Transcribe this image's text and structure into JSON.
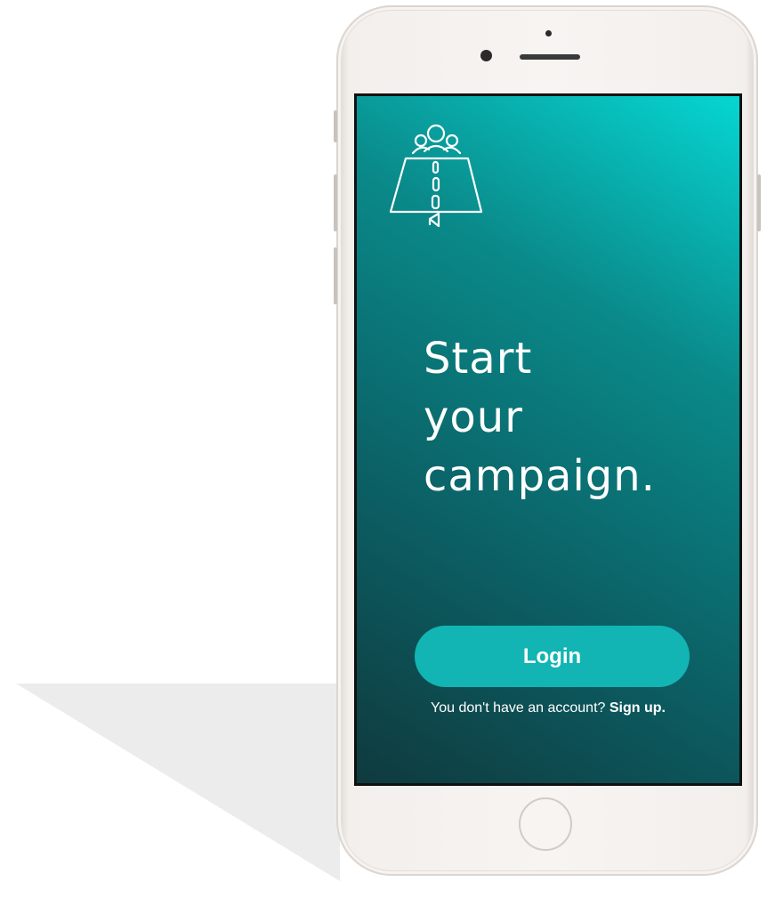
{
  "screen": {
    "logo": {
      "icon": "campaign-road-icon"
    },
    "headline": {
      "line1": "Start",
      "line2": "your",
      "line3": "campaign."
    },
    "login_button": {
      "label": "Login"
    },
    "signup_prompt": {
      "text": "You don't have an account? ",
      "link_label": "Sign up."
    }
  },
  "colors": {
    "gradient_dark": "#0f3a3e",
    "gradient_light": "#06d6d2",
    "button": "#12b5b3",
    "text": "#ffffff",
    "phone_body": "#f7f4f2"
  }
}
